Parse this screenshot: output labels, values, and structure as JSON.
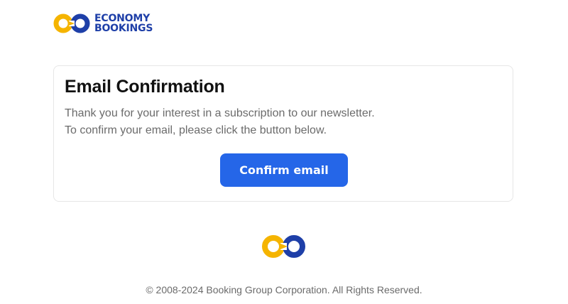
{
  "brand": {
    "name_line1": "ECONOMY",
    "name_line2": "BOOKINGS",
    "logo_icon": "infinity-rings-icon",
    "colors": {
      "yellow": "#f5b400",
      "blue": "#1e3fa8"
    }
  },
  "card": {
    "title": "Email Confirmation",
    "line1": "Thank you for your interest in a subscription to our newsletter.",
    "line2": "To confirm your email, please click the button below.",
    "button_label": "Confirm email",
    "button_color": "#2566e8"
  },
  "footer": {
    "logo_icon": "infinity-rings-icon",
    "copyright": "© 2008-2024 Booking Group Corporation. All Rights Reserved."
  }
}
